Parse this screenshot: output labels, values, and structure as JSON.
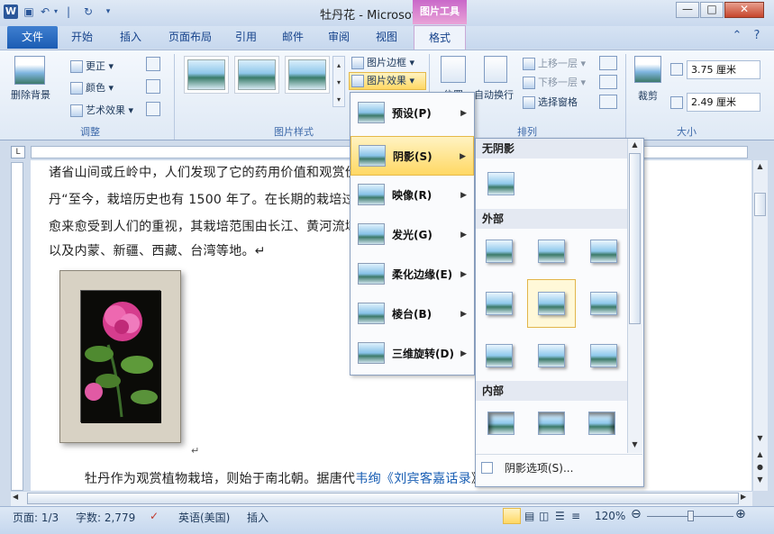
{
  "window": {
    "title": "牡丹花 - Microsoft Word",
    "context_tab": "图片工具",
    "minimize": "—",
    "maximize": "□",
    "close": "✕"
  },
  "tabs": {
    "file": "文件",
    "items": [
      "开始",
      "插入",
      "页面布局",
      "引用",
      "邮件",
      "审阅",
      "视图",
      "格式"
    ]
  },
  "ribbon": {
    "adjust": {
      "remove_bg": "删除背景",
      "corrections": "更正",
      "color": "颜色",
      "artistic": "艺术效果",
      "group": "调整"
    },
    "styles": {
      "group": "图片样式",
      "border": "图片边框",
      "effects": "图片效果"
    },
    "arrange": {
      "position": "位置",
      "wrap": "自动换行",
      "forward": "上移一层",
      "backward": "下移一层",
      "pane": "选择窗格",
      "group": "排列"
    },
    "size": {
      "crop": "裁剪",
      "height": "3.75 厘米",
      "width": "2.49 厘米",
      "group": "大小"
    }
  },
  "document": {
    "lines": [
      "诸省山间或丘岭中，人们发现了它的药用价值和观赏价",
      "丹“至今，栽培历史也有 1500 年了。在长期的栽培过程",
      "愈来愈受到人们的重视，其栽培范围由长江、黄河流域",
      "以及内蒙、新疆、西藏、台湾等地。↵"
    ],
    "para_mark": "↵",
    "bottom_prefix": "牡丹作为观赏植物栽培，则始于南北朝。据唐代",
    "bottom_link1": "韦绚",
    "bottom_link2": "《刘宾客嘉话录",
    "bottom_suffix": "》"
  },
  "effects_menu": {
    "items": [
      {
        "label": "预设(P)"
      },
      {
        "label": "阴影(S)"
      },
      {
        "label": "映像(R)"
      },
      {
        "label": "发光(G)"
      },
      {
        "label": "柔化边缘(E)"
      },
      {
        "label": "棱台(B)"
      },
      {
        "label": "三维旋转(D)"
      }
    ]
  },
  "shadow_menu": {
    "no_shadow": "无阴影",
    "outer": "外部",
    "inner": "内部",
    "options": "阴影选项(S)..."
  },
  "status": {
    "page": "页面: 1/3",
    "words": "字数: 2,779",
    "language": "英语(美国)",
    "mode": "插入",
    "zoom": "120%"
  }
}
